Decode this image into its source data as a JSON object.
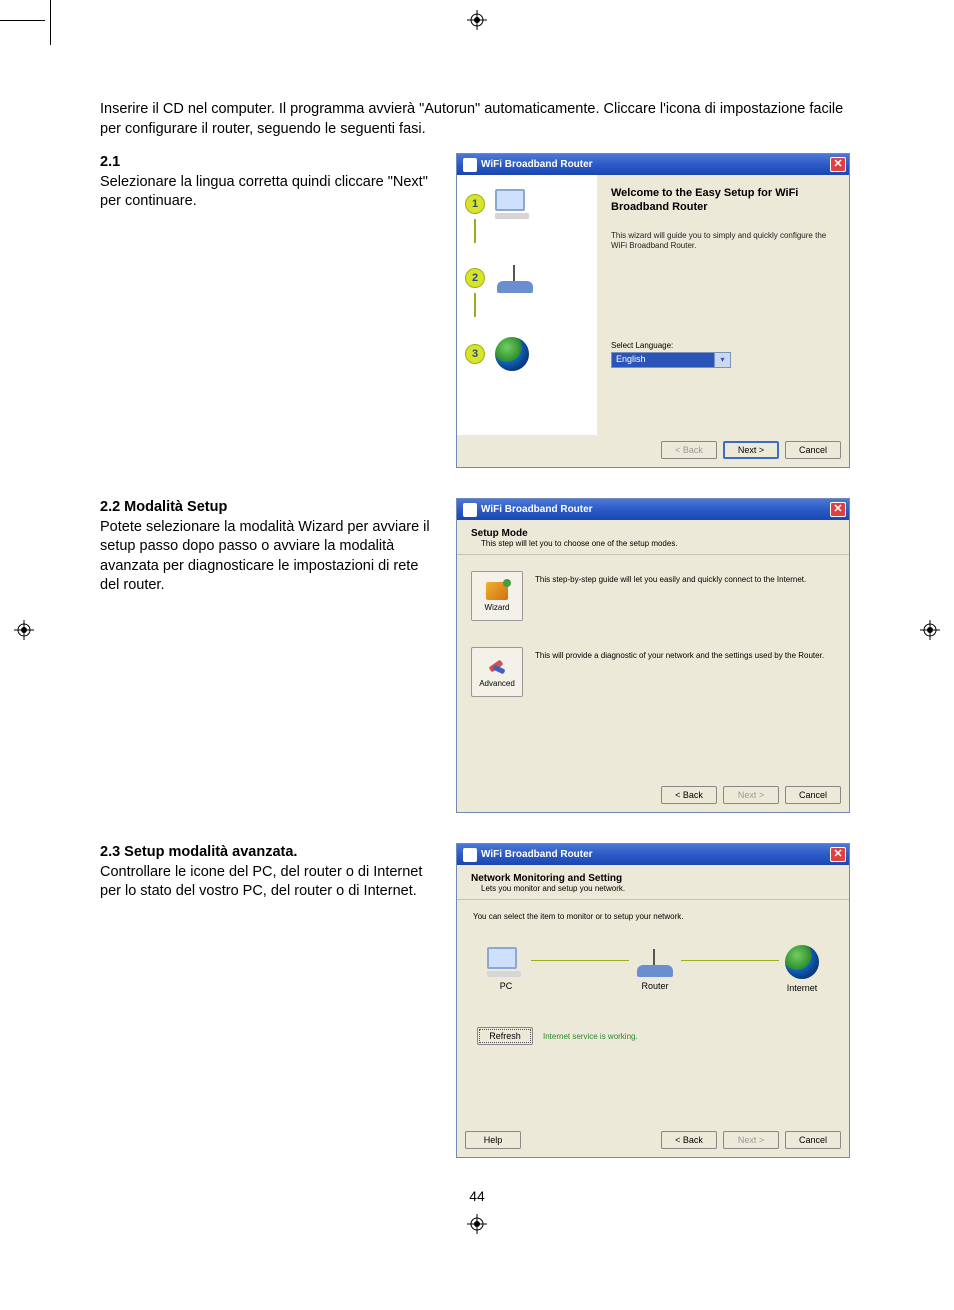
{
  "intro": "Inserire il CD nel computer. Il programma avvierà \"Autorun\" automaticamente. Cliccare l'icona di impostazione facile per configurare il router, seguendo le seguenti fasi.",
  "s21": {
    "heading": "2.1",
    "body": "Selezionare la lingua corretta quindi cliccare \"Next\" per continuare."
  },
  "s22": {
    "heading": "2.2 Modalità Setup",
    "body": "Potete selezionare la modalità Wizard per avviare il setup passo dopo passo o avviare la modalità avanzata per diagnosticare le impostazioni di rete del router."
  },
  "s23": {
    "heading": "2.3 Setup modalità avanzata.",
    "body": "Controllare le icone del PC, del router o di Internet per lo stato del vostro PC, del router o di Internet."
  },
  "dlg": {
    "title": "WiFi Broadband Router",
    "back": "< Back",
    "next": "Next >",
    "cancel": "Cancel",
    "help": "Help",
    "refresh": "Refresh"
  },
  "dlg1": {
    "welcome_title": "Welcome to the Easy Setup for WiFi Broadband Router",
    "welcome_sub": "This wizard will guide you to simply and quickly configure the WiFi Broadband Router.",
    "lang_label": "Select Language:",
    "lang_value": "English",
    "steps": [
      "1",
      "2",
      "3"
    ]
  },
  "dlg2": {
    "h1": "Setup Mode",
    "h2": "This step will let you to choose one of the setup modes.",
    "wizard_label": "Wizard",
    "wizard_desc": "This step-by-step guide will let you easily and quickly connect to the Internet.",
    "advanced_label": "Advanced",
    "advanced_desc": "This will provide a diagnostic of your network and the settings used by the Router."
  },
  "dlg3": {
    "h1": "Network Monitoring and Setting",
    "h2": "Lets you monitor and setup you network.",
    "instr": "You can select the item to monitor or to setup your network.",
    "pc": "PC",
    "router": "Router",
    "internet": "Internet",
    "status": "Internet service is working."
  },
  "page_number": "44"
}
